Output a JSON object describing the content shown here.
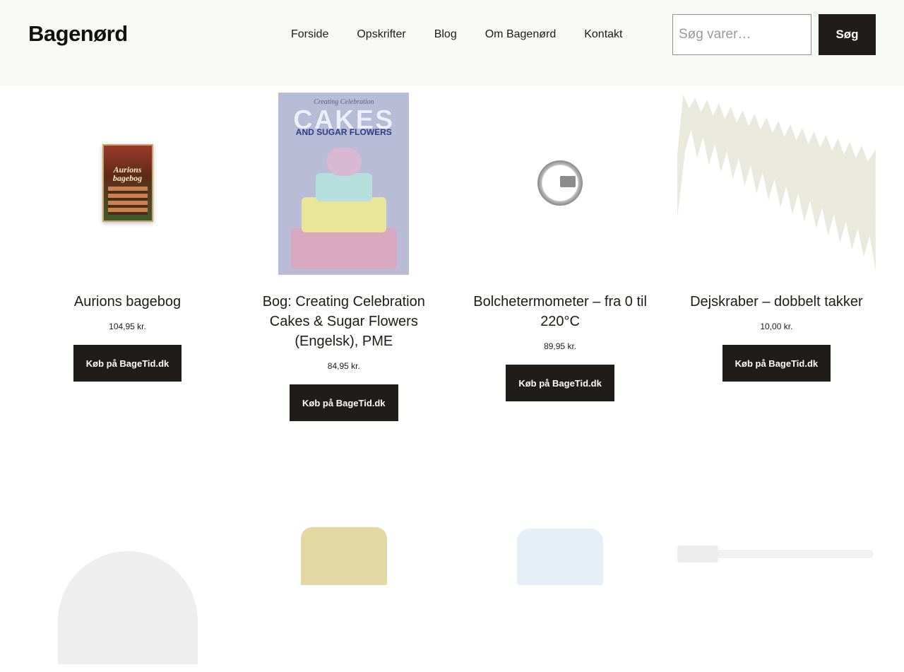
{
  "header": {
    "logo": "Bagenørd",
    "nav": [
      "Forside",
      "Opskrifter",
      "Blog",
      "Om Bagenørd",
      "Kontakt"
    ],
    "search_placeholder": "Søg varer…",
    "search_button": "Søg"
  },
  "products": [
    {
      "title": "Aurions bagebog",
      "price": "104,95 kr.",
      "button": "Køb på BageTid.dk",
      "image_text": "Aurions bagebog"
    },
    {
      "title": "Bog: Creating Celebration Cakes & Sugar Flowers (Engelsk), PME",
      "price": "84,95 kr.",
      "button": "Køb på BageTid.dk",
      "image_text": {
        "top": "Creating Celebration",
        "main": "CAKES",
        "sub": "AND SUGAR FLOWERS"
      }
    },
    {
      "title": "Bolchetermometer – fra 0 til 220°C",
      "price": "89,95 kr.",
      "button": "Køb på BageTid.dk"
    },
    {
      "title": "Dejskraber – dobbelt takker",
      "price": "10,00 kr.",
      "button": "Køb på BageTid.dk"
    }
  ]
}
